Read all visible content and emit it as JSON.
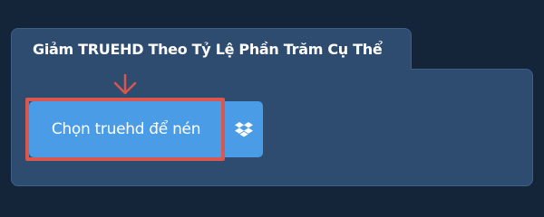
{
  "panel": {
    "title": "Giảm TRUEHD Theo Tỷ Lệ Phần Trăm Cụ Thể"
  },
  "upload": {
    "choose_label": "Chọn truehd để nén",
    "dropbox_icon": "dropbox-icon"
  },
  "annotation": {
    "highlight_color": "#d9574e",
    "arrow_icon": "arrow-down-icon"
  },
  "colors": {
    "background": "#14253a",
    "panel": "#2d4c6f",
    "button": "#4a9ce6"
  }
}
